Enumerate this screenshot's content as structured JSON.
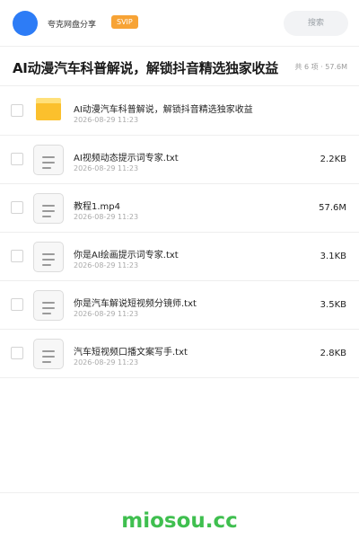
{
  "header": {
    "share_name": "夸克网盘分享",
    "badge": "SVIP",
    "search_placeholder": "搜索"
  },
  "share": {
    "title": "AI动漫汽车科普解说，解锁抖音精选独家收益",
    "meta": "共 6 项 · 57.6M"
  },
  "files": [
    {
      "name": "AI动漫汽车科普解说，解锁抖音精选独家收益",
      "date": "2026-08-29 11:23",
      "size": "",
      "icon": "folder-icon"
    },
    {
      "name": "AI视频动态提示词专家.txt",
      "date": "2026-08-29 11:23",
      "size": "2.2KB",
      "icon": "text-file-icon"
    },
    {
      "name": "教程1.mp4",
      "date": "2026-08-29 11:23",
      "size": "57.6M",
      "icon": "text-file-icon"
    },
    {
      "name": "你是AI绘画提示词专家.txt",
      "date": "2026-08-29 11:23",
      "size": "3.1KB",
      "icon": "text-file-icon"
    },
    {
      "name": "你是汽车解说短视频分镜师.txt",
      "date": "2026-08-29 11:23",
      "size": "3.5KB",
      "icon": "text-file-icon"
    },
    {
      "name": "汽车短视频口播文案写手.txt",
      "date": "2026-08-29 11:23",
      "size": "2.8KB",
      "icon": "text-file-icon"
    }
  ],
  "footer": {
    "watermark": "miosou.cc"
  },
  "colors": {
    "avatar": "#2d7cf6",
    "svip_badge": "#f7a335",
    "folder": "#fbc02d",
    "watermark": "#3fbf4f"
  }
}
